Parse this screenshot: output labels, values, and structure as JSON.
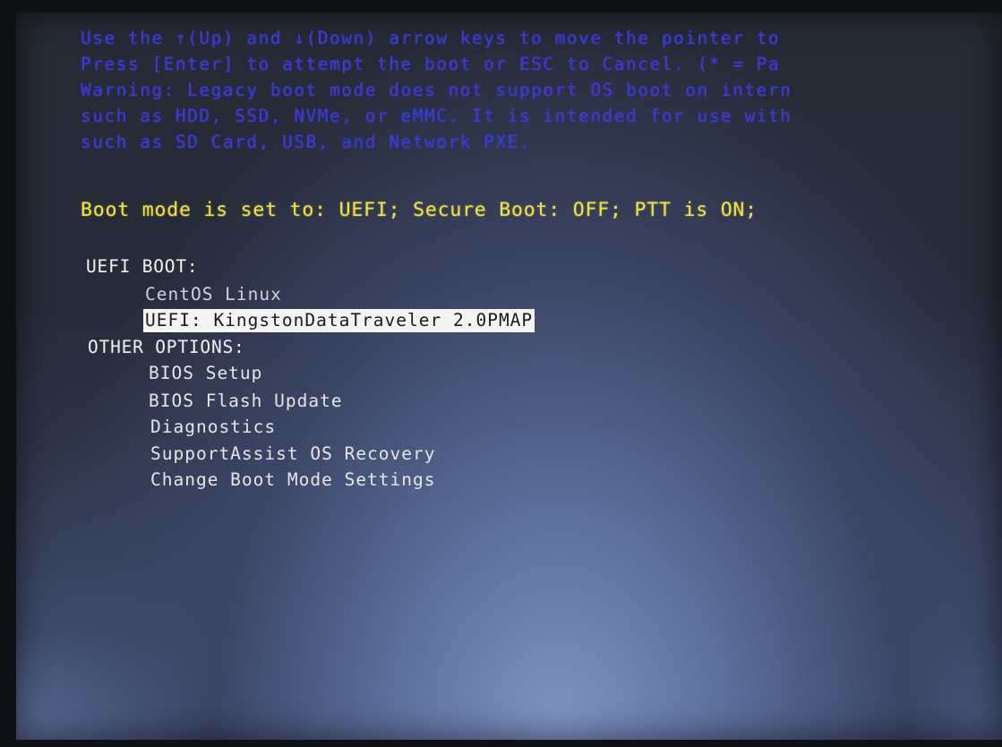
{
  "screen": {
    "warning_lines": [
      "Use the ↑(Up) and ↓(Down) arrow keys to move the pointer to",
      "Press [Enter] to attempt the boot or ESC to Cancel. (* = Pa",
      "Warning: Legacy boot mode does not support OS boot on intern",
      "such as HDD, SSD, NVMe, or eMMC. It is intended for use with",
      "such as SD Card, USB, and Network PXE."
    ],
    "boot_mode_status": "Boot mode is set to: UEFI; Secure Boot: OFF; PTT is ON;",
    "uefi_boot": {
      "header": "UEFI BOOT:",
      "items": [
        {
          "label": "CentOS Linux"
        },
        {
          "label": "UEFI: KingstonDataTraveler 2.0PMAP",
          "selected": true
        }
      ]
    },
    "other_options": {
      "header": "OTHER OPTIONS:",
      "items": [
        {
          "label": "BIOS Setup"
        },
        {
          "label": "BIOS Flash Update"
        },
        {
          "label": "Diagnostics"
        },
        {
          "label": "SupportAssist OS Recovery"
        },
        {
          "label": "Change Boot Mode Settings"
        }
      ]
    }
  },
  "colors": {
    "warning_text": "#3d3bd6",
    "status_text": "#f2e24a",
    "menu_text": "#e6e6e6",
    "selection_bg": "#f4f4f4"
  }
}
